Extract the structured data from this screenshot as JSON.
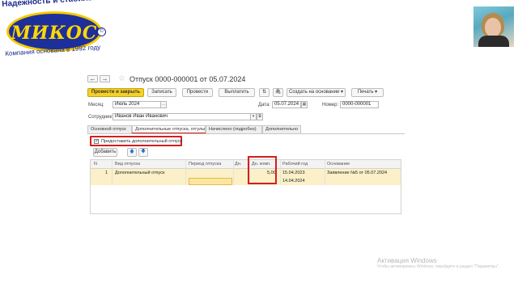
{
  "logo": {
    "top_text": "Надежность и стабильность",
    "name": "МИКОС",
    "copyright": "©",
    "bottom_text": "Компания основана в 1992 году"
  },
  "window": {
    "title": "Отпуск 0000-000001 от 05.07.2024",
    "nav_back": "←",
    "nav_forward": "→",
    "star": "☆"
  },
  "toolbar": {
    "post_close": "Провести и закрыть",
    "save": "Записать",
    "post": "Провести",
    "pay": "Выплатить",
    "create_based_on": "Создать на основании ▾",
    "print": "Печать ▾"
  },
  "fields": {
    "month_label": "Месяц:",
    "month_value": "Июль 2024",
    "date_label": "Дата:",
    "date_value": "05.07.2024",
    "number_label": "Номер:",
    "number_value": "0000-000001",
    "employee_label": "Сотрудник:",
    "employee_value": "Иванов Иван Иванович"
  },
  "tabs": [
    "Основной отпуск",
    "Дополнительные отпуска, отгулы",
    "Начислено (подробно)",
    "Дополнительно"
  ],
  "checkbox": {
    "checked": "✓",
    "label": "Предоставить дополнительный отпуск"
  },
  "add_button": "Добавить",
  "up_arrow": "🡅",
  "down_arrow": "🡇",
  "table": {
    "headers": [
      "N",
      "Вид отпуска",
      "Период отпуска",
      "Дн.",
      "Дн. комп.",
      "Рабочий год",
      "Основание"
    ],
    "row": {
      "n": "1",
      "kind": "Дополнительный отпуск",
      "days_comp": "5,00",
      "work_year_start": "15.04.2023",
      "work_year_end": "14.04.2024",
      "basis": "Заявление №5 от 05.07.2024"
    }
  },
  "watermark": {
    "line1": "Активация Windows",
    "line2": "Чтобы активировать Windows, перейдите в раздел \"Параметры\"."
  }
}
